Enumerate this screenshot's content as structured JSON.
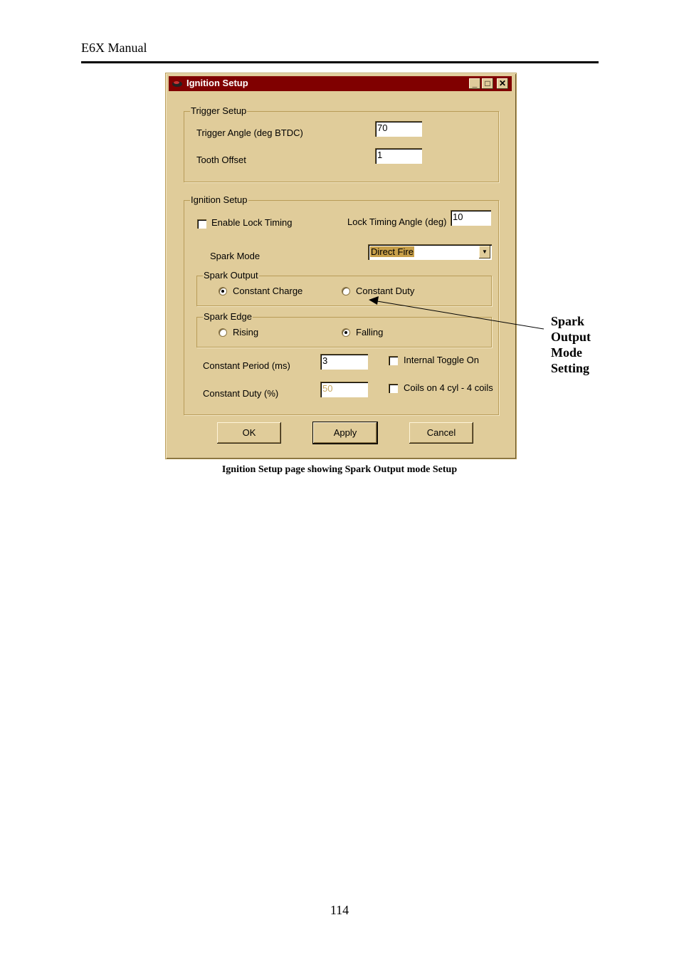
{
  "page": {
    "header": "E6X Manual",
    "page_number": "114",
    "caption": "Ignition Setup page showing Spark Output mode Setup",
    "annotation": [
      "Spark",
      "Output",
      "Mode",
      "Setting"
    ]
  },
  "window": {
    "title": "Ignition Setup",
    "title_bar_color": "#800000",
    "controls": {
      "minimize": "_",
      "maximize": "□",
      "close": "✕"
    },
    "trigger_setup": {
      "group_label": "Trigger Setup",
      "trigger_angle_label": "Trigger Angle (deg BTDC)",
      "trigger_angle_value": "70",
      "tooth_offset_label": "Tooth Offset",
      "tooth_offset_value": "1"
    },
    "ignition_setup": {
      "group_label": "Ignition Setup",
      "enable_lock_timing_label": "Enable Lock Timing",
      "enable_lock_timing_checked": false,
      "lock_timing_angle_label": "Lock Timing Angle (deg)",
      "lock_timing_angle_value": "10",
      "spark_mode_label": "Spark Mode",
      "spark_mode_value": "Direct Fire",
      "spark_output": {
        "group_label": "Spark Output",
        "options": [
          "Constant Charge",
          "Constant Duty"
        ],
        "selected": "Constant Charge"
      },
      "spark_edge": {
        "group_label": "Spark Edge",
        "options": [
          "Rising",
          "Falling"
        ],
        "selected": "Falling"
      },
      "constant_period_label": "Constant Period (ms)",
      "constant_period_value": "3",
      "constant_duty_label": "Constant Duty (%)",
      "constant_duty_value": "50",
      "internal_toggle_label": "Internal Toggle On",
      "internal_toggle_checked": false,
      "coils_label": "Coils on 4 cyl - 4 coils",
      "coils_checked": false
    },
    "buttons": {
      "ok": "OK",
      "apply": "Apply",
      "cancel": "Cancel"
    }
  }
}
